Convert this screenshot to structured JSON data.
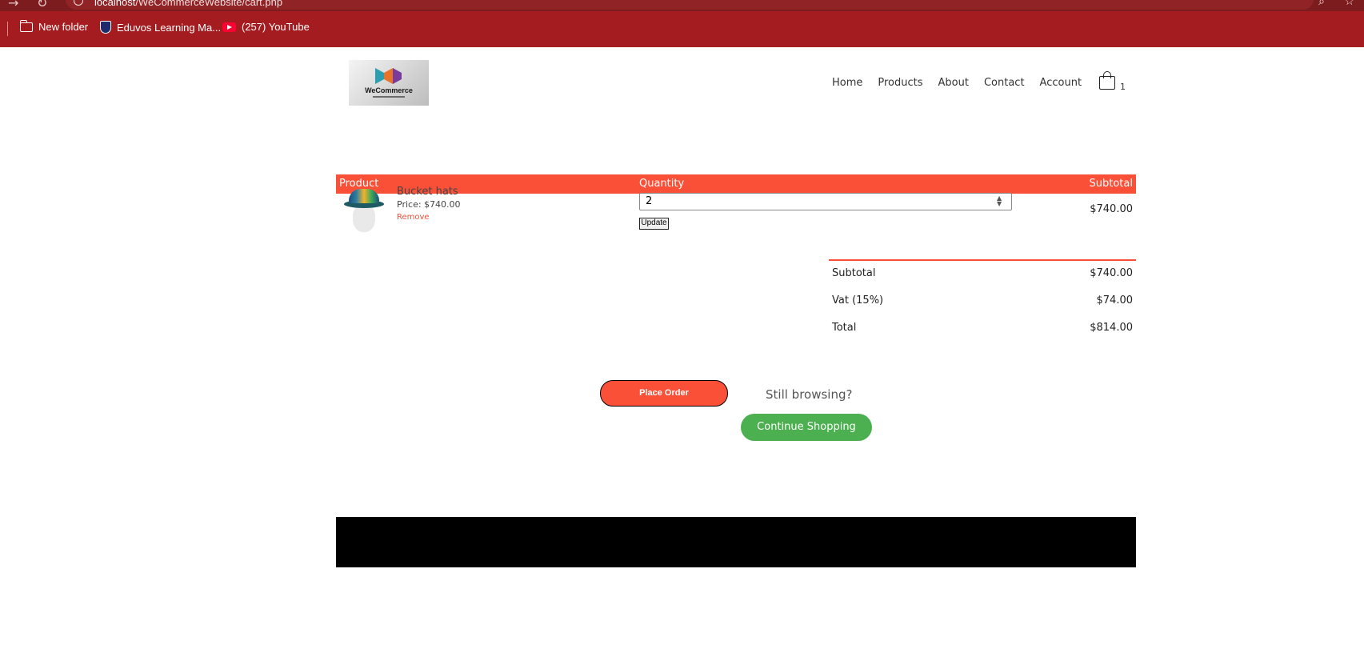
{
  "browser": {
    "url_host": "localhost",
    "url_path": "/WeCommerceWebsite/cart.php",
    "bookmarks": [
      {
        "label": "New folder",
        "icon": "folder-icon"
      },
      {
        "label": "Eduvos Learning Ma...",
        "icon": "eduvos-shield-icon"
      },
      {
        "label": "(257) YouTube",
        "icon": "youtube-icon"
      }
    ]
  },
  "header": {
    "logo_text": "WeCommerce",
    "nav": [
      "Home",
      "Products",
      "About",
      "Contact",
      "Account"
    ],
    "cart_count": "1"
  },
  "cart_table": {
    "headers": {
      "product": "Product",
      "quantity": "Quantity",
      "subtotal": "Subtotal"
    },
    "items": [
      {
        "name": "Bucket hats",
        "price": "Price: $740.00",
        "remove_label": "Remove",
        "quantity": "2",
        "update_label": "Update",
        "subtotal": "$740.00"
      }
    ]
  },
  "totals": {
    "subtotal_label": "Subtotal",
    "subtotal_value": "$740.00",
    "vat_label": "Vat (15%)",
    "vat_value": "$74.00",
    "total_label": "Total",
    "total_value": "$814.00"
  },
  "actions": {
    "place_order": "Place Order",
    "still_browsing": "Still browsing?",
    "continue_shopping": "Continue Shopping"
  },
  "colors": {
    "accent": "#fa5038",
    "continue_green": "#4caf50",
    "bookmark_bar": "#a51c20",
    "footer": "#000000"
  }
}
